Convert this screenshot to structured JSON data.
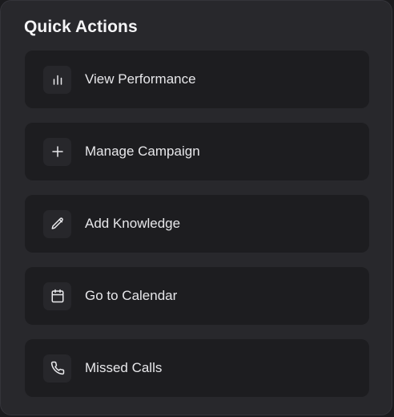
{
  "title": "Quick Actions",
  "actions": [
    {
      "label": "View Performance",
      "icon": "bar-chart-icon"
    },
    {
      "label": "Manage Campaign",
      "icon": "plus-icon"
    },
    {
      "label": "Add Knowledge",
      "icon": "pencil-icon"
    },
    {
      "label": "Go to Calendar",
      "icon": "calendar-icon"
    },
    {
      "label": "Missed Calls",
      "icon": "phone-icon"
    }
  ]
}
